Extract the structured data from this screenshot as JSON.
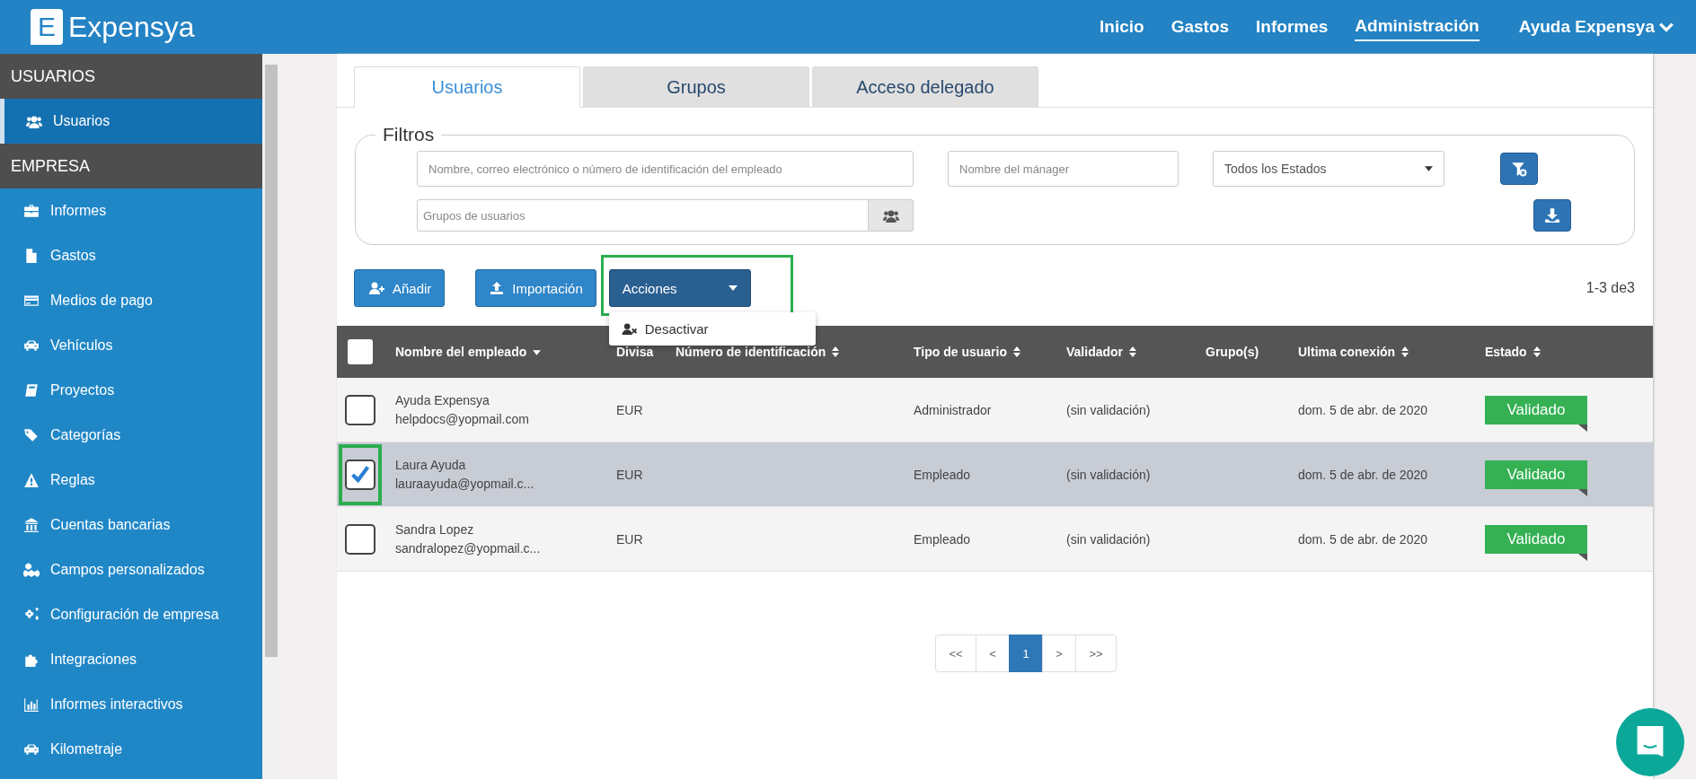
{
  "header": {
    "logo_letter": "E",
    "logo_text": "Expensya",
    "nav": [
      {
        "label": "Inicio",
        "selected": false
      },
      {
        "label": "Gastos",
        "selected": false
      },
      {
        "label": "Informes",
        "selected": false
      },
      {
        "label": "Administración",
        "selected": true
      }
    ],
    "user_menu": "Ayuda Expensya"
  },
  "sidebar": [
    {
      "title": "USUARIOS",
      "items": [
        {
          "label": "Usuarios",
          "selected": true
        }
      ]
    },
    {
      "title": "EMPRESA",
      "items": [
        {
          "label": "Informes",
          "selected": false
        },
        {
          "label": "Gastos",
          "selected": false
        },
        {
          "label": "Medios de pago",
          "selected": false
        },
        {
          "label": "Vehículos",
          "selected": false
        },
        {
          "label": "Proyectos",
          "selected": false
        },
        {
          "label": "Categorías",
          "selected": false
        },
        {
          "label": "Reglas",
          "selected": false
        },
        {
          "label": "Cuentas bancarias",
          "selected": false
        },
        {
          "label": "Campos personalizados",
          "selected": false
        },
        {
          "label": "Configuración de empresa",
          "selected": false
        },
        {
          "label": "Integraciones",
          "selected": false
        },
        {
          "label": "Informes interactivos",
          "selected": false
        },
        {
          "label": "Kilometraje",
          "selected": false
        }
      ]
    }
  ],
  "tabs": [
    {
      "label": "Usuarios",
      "selected": true
    },
    {
      "label": "Grupos",
      "selected": false
    },
    {
      "label": "Acceso delegado",
      "selected": false
    }
  ],
  "filters": {
    "legend": "Filtros",
    "search": {
      "placeholder": "Nombre, correo electrónico o número de identificación del empleado"
    },
    "manager": {
      "placeholder": "Nombre del mánager"
    },
    "status": {
      "value": "Todos los Estados"
    },
    "groups": {
      "placeholder": "Grupos de usuarios"
    }
  },
  "toolbar": {
    "add": "Añadir",
    "import": "Importación",
    "actions": {
      "label": "Acciones",
      "highlighted": true
    },
    "menu": [
      {
        "label": "Desactivar"
      }
    ],
    "count": "1-3 de3"
  },
  "table": {
    "all_checked": false,
    "columns": [
      {
        "label": "Nombre del empleado",
        "kind": "sorted"
      },
      {
        "label": "Divisa",
        "kind": "plain"
      },
      {
        "label": "Número de identificación",
        "kind": "sortable"
      },
      {
        "label": "Tipo de usuario",
        "kind": "sortable"
      },
      {
        "label": "Validador",
        "kind": "sortable"
      },
      {
        "label": "Grupo(s)",
        "kind": "plain"
      },
      {
        "label": "Ultima conexión",
        "kind": "sortable"
      },
      {
        "label": "Estado",
        "kind": "sortable"
      }
    ],
    "rows": [
      {
        "name": "Ayuda Expensya",
        "email": "helpdocs@yopmail.com",
        "currency": "EUR",
        "type": "Administrador",
        "validator": "(sin validación)",
        "last_login": "dom. 5 de abr. de 2020",
        "status": "Validado",
        "selected": false,
        "highlighted": false
      },
      {
        "name": "Laura Ayuda",
        "email": "lauraayuda@yopmail.c...",
        "currency": "EUR",
        "type": "Empleado",
        "validator": "(sin validación)",
        "last_login": "dom. 5 de abr. de 2020",
        "status": "Validado",
        "selected": true,
        "highlighted": true
      },
      {
        "name": "Sandra Lopez",
        "email": "sandralopez@yopmail.c...",
        "currency": "EUR",
        "type": "Empleado",
        "validator": "(sin validación)",
        "last_login": "dom. 5 de abr. de 2020",
        "status": "Validado",
        "selected": false,
        "highlighted": false
      }
    ]
  },
  "pagination": [
    {
      "label": "<<",
      "selected": false
    },
    {
      "label": "<",
      "selected": false
    },
    {
      "label": "1",
      "selected": true
    },
    {
      "label": ">",
      "selected": false
    },
    {
      "label": ">>",
      "selected": false
    }
  ]
}
